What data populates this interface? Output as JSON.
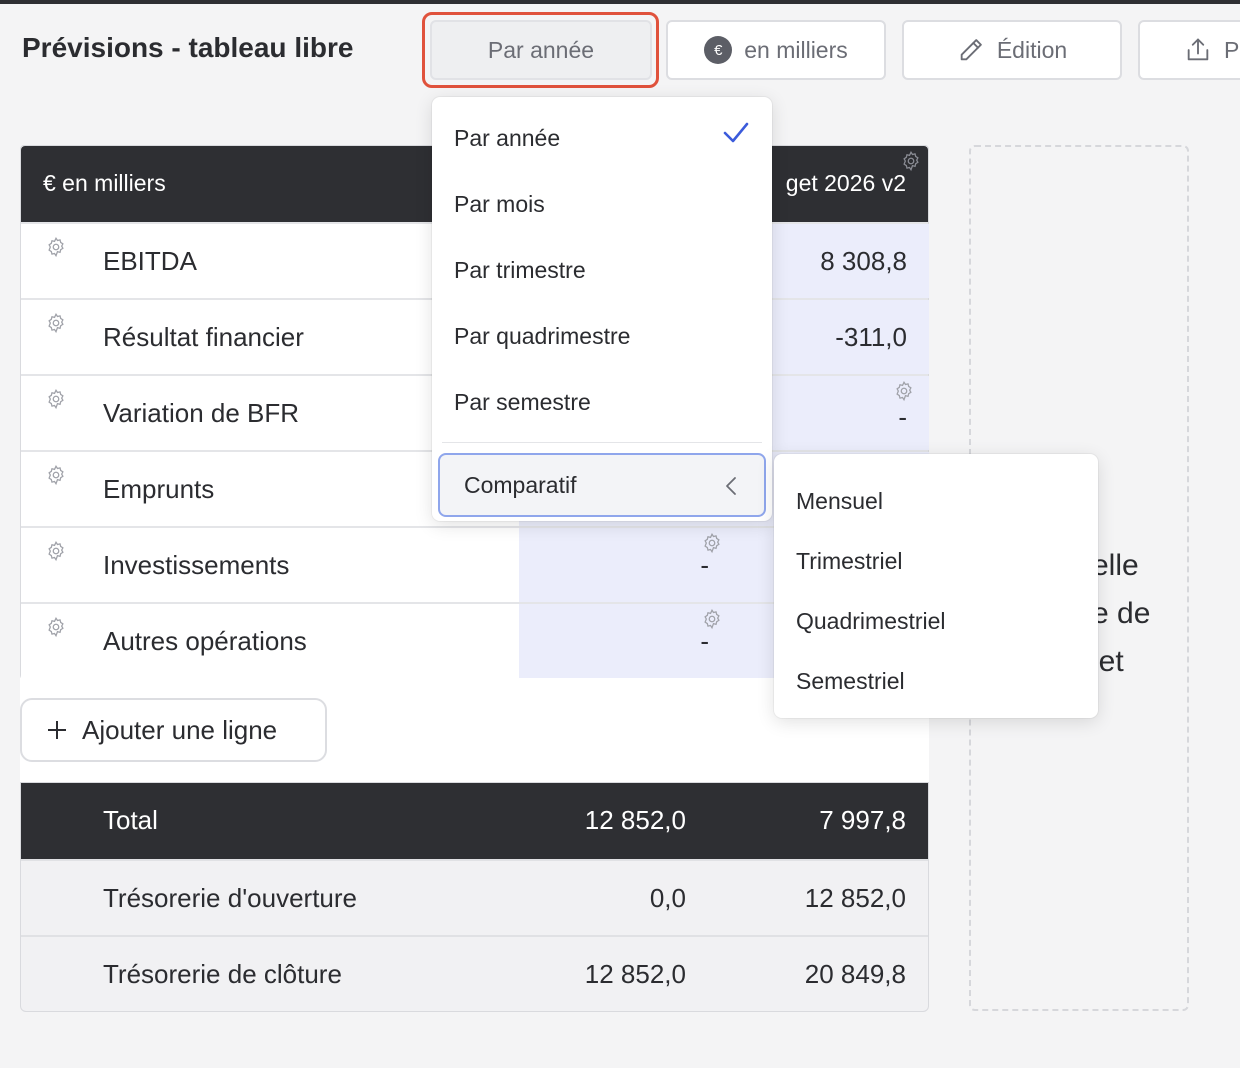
{
  "header": {
    "title": "Prévisions - tableau libre",
    "period_button": "Par année",
    "units_button": "en milliers",
    "units_badge": "€",
    "edit_button": "Édition",
    "export_button": "P"
  },
  "table": {
    "units_label": "€ en milliers",
    "column_label": "get 2026 v2",
    "rows": [
      {
        "label": "EBITDA",
        "col_b": "8 308,8",
        "col_a": ""
      },
      {
        "label": "Résultat financier",
        "col_b": "-311,0",
        "col_a": ""
      },
      {
        "label": "Variation de BFR",
        "col_b": "-",
        "col_a": ""
      },
      {
        "label": "Emprunts",
        "col_b": "",
        "col_a": ""
      },
      {
        "label": "Investissements",
        "col_b": "",
        "col_a": "-"
      },
      {
        "label": "Autres opérations",
        "col_b": "",
        "col_a": "-"
      }
    ],
    "add_line": "Ajouter une ligne",
    "totals": [
      {
        "label": "Total",
        "v1": "12 852,0",
        "v2": "7 997,8"
      },
      {
        "label": "Trésorerie d'ouverture",
        "v1": "0,0",
        "v2": "12 852,0"
      },
      {
        "label": "Trésorerie de clôture",
        "v1": "12 852,0",
        "v2": "20 849,8"
      }
    ]
  },
  "side_panel": {
    "lines": [
      "elle",
      "e de",
      "jet"
    ]
  },
  "dropdown": {
    "items": [
      "Par année",
      "Par mois",
      "Par trimestre",
      "Par quadrimestre",
      "Par semestre"
    ],
    "selected": "Par année",
    "comparatif": "Comparatif"
  },
  "submenu": {
    "items": [
      "Mensuel",
      "Trimestriel",
      "Quadrimestriel",
      "Semestriel"
    ]
  },
  "colors": {
    "header_dark": "#2e2f33",
    "highlight_red": "#e0523c",
    "cell_blue": "#ebedfb",
    "check_blue": "#3b5bdb",
    "focus_blue": "#8fa6ec"
  }
}
